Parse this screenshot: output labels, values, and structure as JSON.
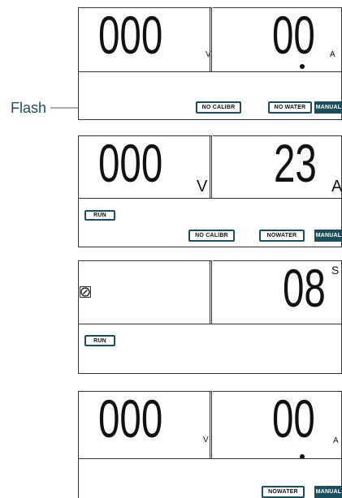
{
  "annotation": {
    "flash_label": "Flash"
  },
  "panel1": {
    "voltage": "000",
    "voltage_unit": "V",
    "current": "00",
    "current_unit": "A",
    "badges": {
      "no_calibr": "NO CALIBR",
      "no_water": "NO WATER",
      "manual": "MANUAL"
    }
  },
  "panel2": {
    "voltage": "000",
    "voltage_unit": "V",
    "current": "23",
    "current_unit": "A",
    "run": "RUN",
    "badges": {
      "no_calibr": "NO CALIBR",
      "no_water": "NOWATER",
      "manual": "MANUAL"
    }
  },
  "panel3": {
    "timer": "08",
    "timer_unit": "S",
    "icon": "gauge-icon",
    "run": "RUN"
  },
  "panel4": {
    "voltage": "000",
    "voltage_unit": "V",
    "current": "00",
    "current_unit": "A",
    "badges": {
      "no_water": "NOWATER",
      "manual": "MANUAL"
    }
  },
  "colors": {
    "accent": "#1d4e5e",
    "line": "#333333",
    "text": "#111111"
  }
}
